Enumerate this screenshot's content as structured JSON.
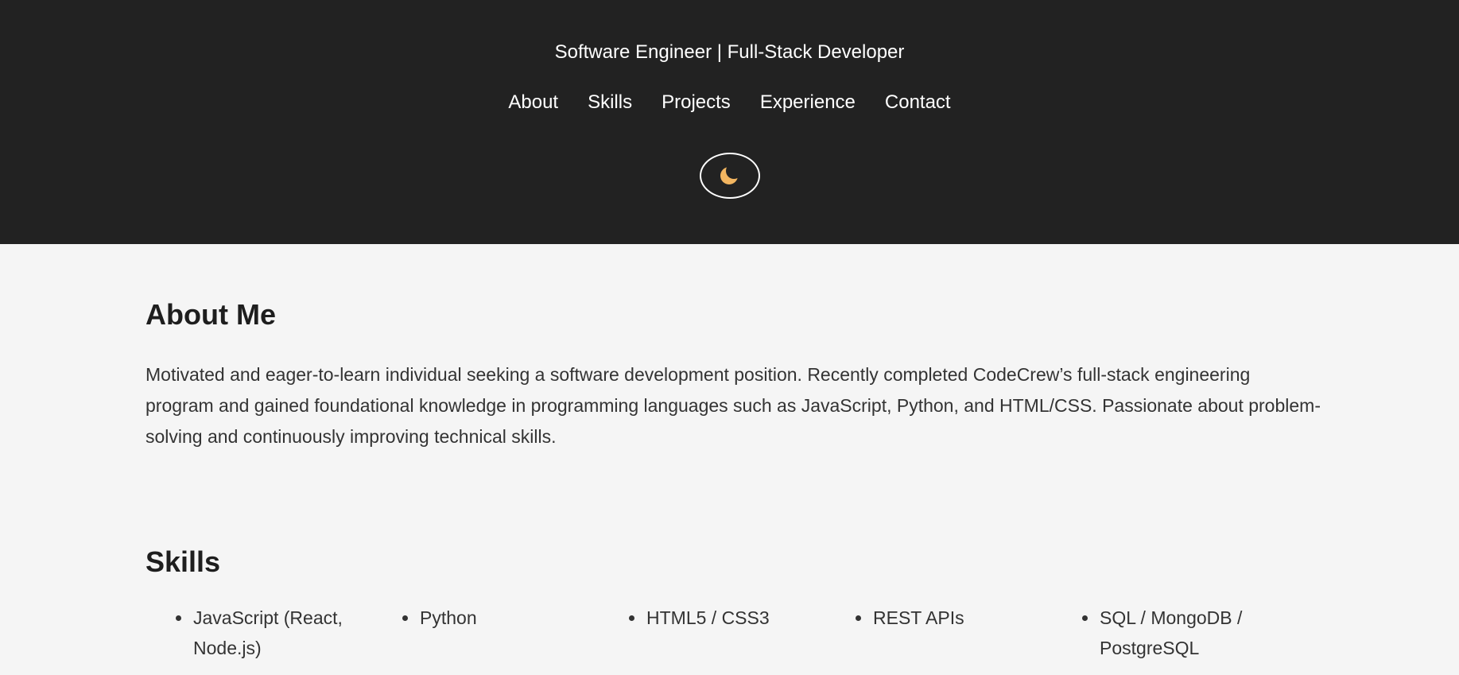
{
  "header": {
    "subtitle": "Software Engineer | Full-Stack Developer",
    "nav": [
      "About",
      "Skills",
      "Projects",
      "Experience",
      "Contact"
    ],
    "theme_toggle_icon": "moon-icon"
  },
  "about": {
    "heading": "About Me",
    "text": "Motivated and eager-to-learn individual seeking a software development position. Recently completed CodeCrew’s full-stack engineering program and gained foundational knowledge in programming languages such as JavaScript, Python, and HTML/CSS. Passionate about problem-solving and continuously improving technical skills."
  },
  "skills": {
    "heading": "Skills",
    "items": [
      "JavaScript (React, Node.js)",
      "Python",
      "HTML5 / CSS3",
      "REST APIs",
      "SQL / MongoDB / PostgreSQL"
    ]
  },
  "colors": {
    "header_bg": "#222222",
    "page_bg": "#f5f5f5",
    "moon": "#f2b560"
  }
}
